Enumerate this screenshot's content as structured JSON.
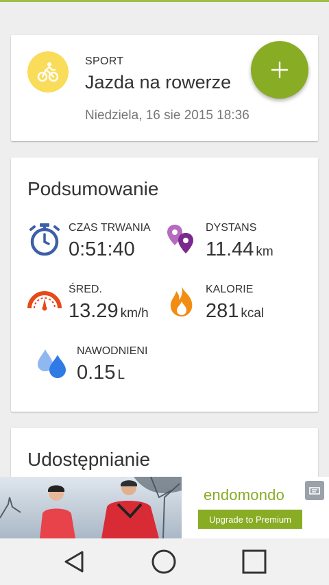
{
  "colors": {
    "accent": "#88ac24",
    "sport_icon_bg": "#f9dc5a",
    "page_bg": "#eeeeee"
  },
  "sport": {
    "kicker": "SPORT",
    "name": "Jazda na rowerze",
    "date": "Niedziela, 16 sie 2015 18:36",
    "icon": "bicycle-icon",
    "fab_icon": "plus-icon"
  },
  "summary": {
    "title": "Podsumowanie",
    "stats": [
      {
        "label": "CZAS TRWANIA",
        "value": "0:51:40",
        "unit": "",
        "icon": "stopwatch-icon"
      },
      {
        "label": "DYSTANS",
        "value": "11.44",
        "unit": "km",
        "icon": "map-pin-icon"
      },
      {
        "label": "ŚRED.",
        "value": "13.29",
        "unit": "km/h",
        "icon": "speedometer-icon"
      },
      {
        "label": "KALORIE",
        "value": "281",
        "unit": "kcal",
        "icon": "flame-icon"
      },
      {
        "label": "NAWODNIENI",
        "value": "0.15",
        "unit": "L",
        "icon": "water-drops-icon"
      }
    ]
  },
  "share": {
    "title": "Udostępnianie"
  },
  "ad": {
    "brand": "endomondo",
    "cta": "Upgrade to Premium",
    "close_icon": "ad-close-icon"
  },
  "navbar": {
    "back_icon": "back-icon",
    "home_icon": "home-icon",
    "recents_icon": "recents-icon"
  }
}
